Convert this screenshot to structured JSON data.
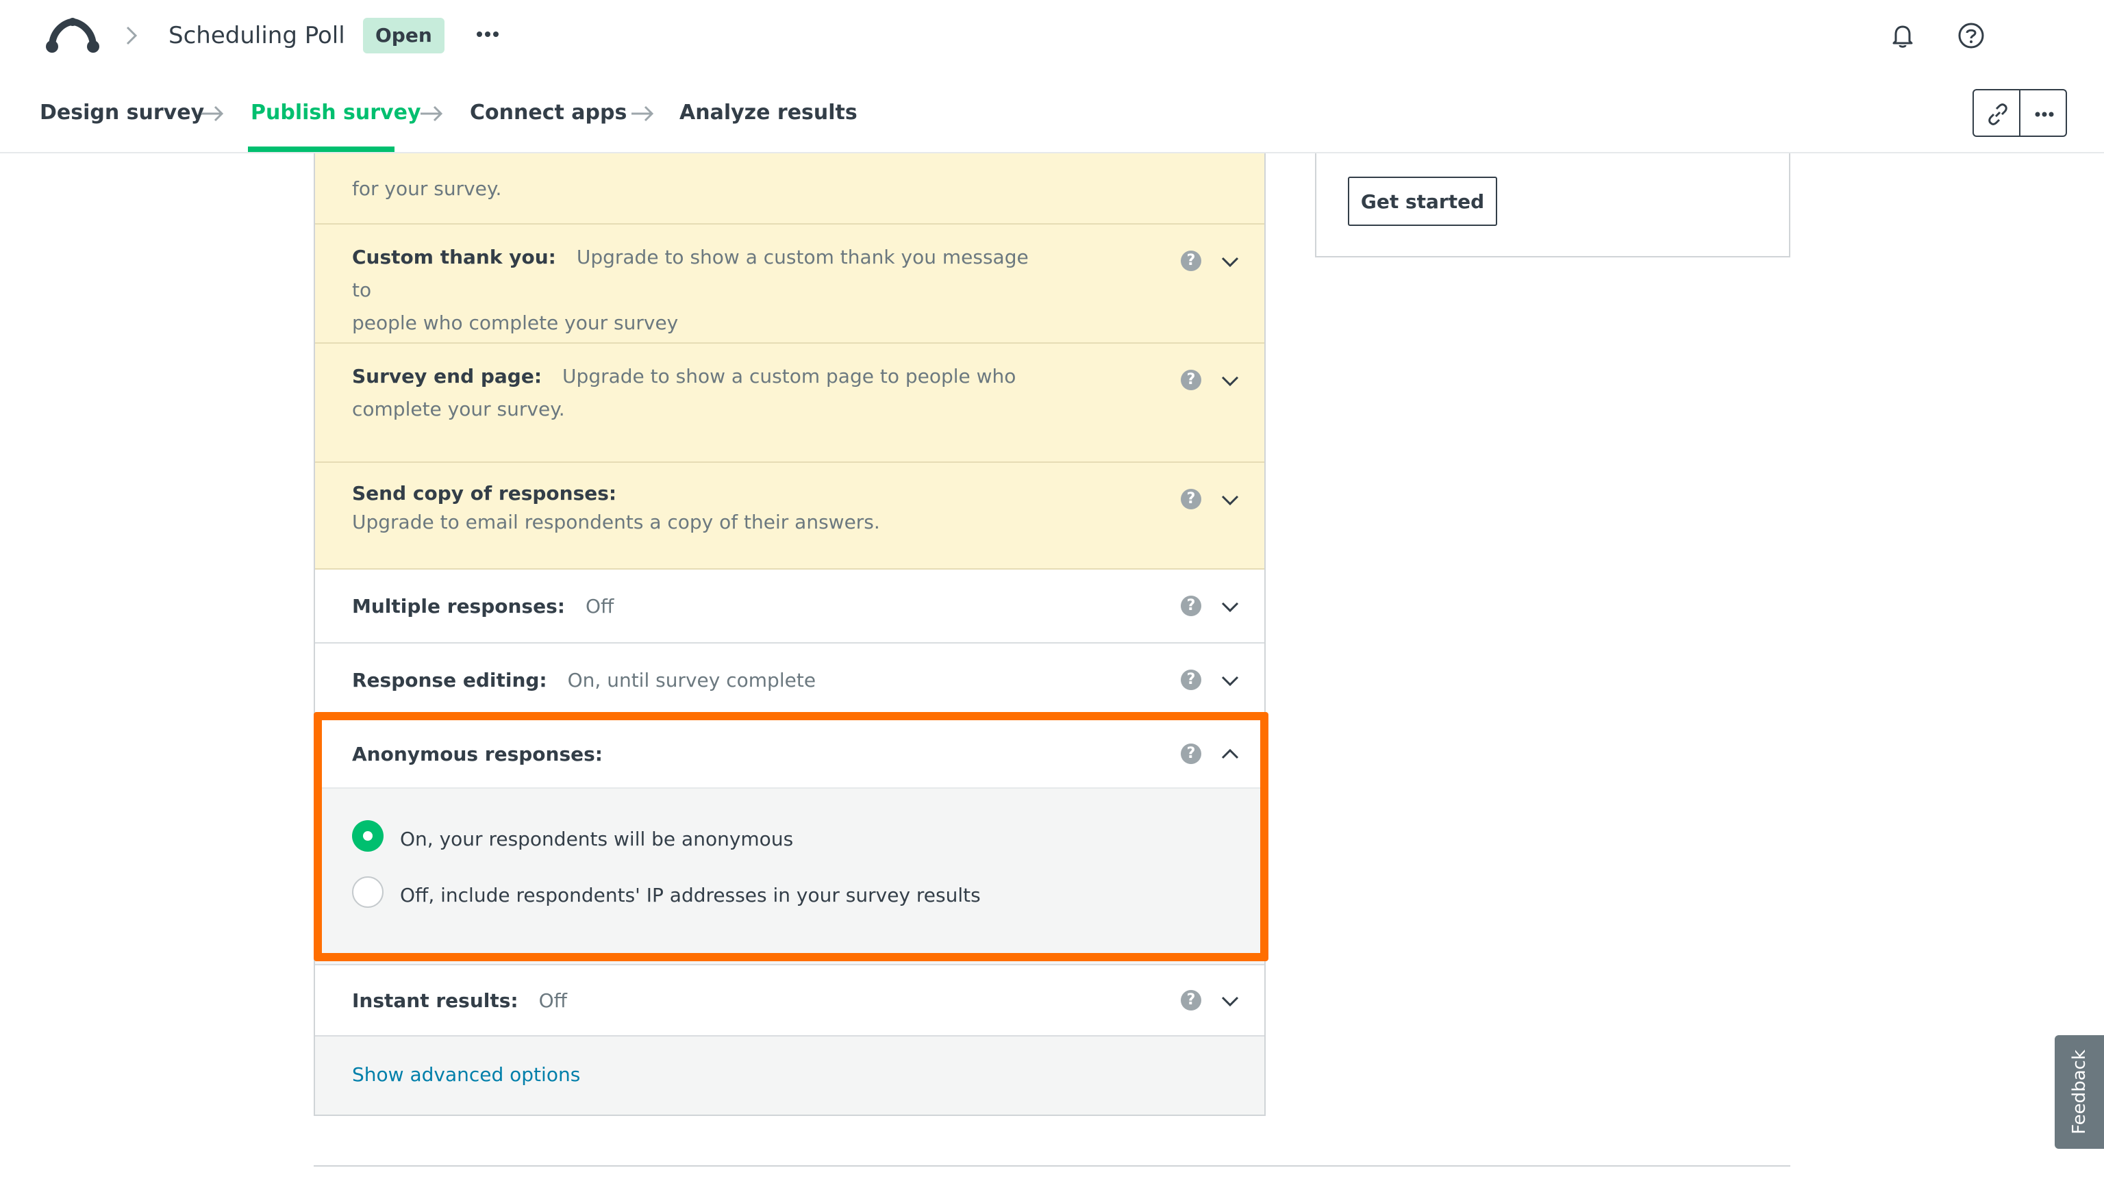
{
  "header": {
    "survey_title": "Scheduling Poll",
    "status": "Open"
  },
  "nav": {
    "steps": [
      {
        "label": "Design survey"
      },
      {
        "label": "Publish survey"
      },
      {
        "label": "Connect apps"
      },
      {
        "label": "Analyze results"
      }
    ],
    "active_step": "Publish survey"
  },
  "options": {
    "recurrence": {
      "desc": "for your survey."
    },
    "custom_thank_you": {
      "title": "Custom thank you:",
      "desc1": "Upgrade to show a custom thank you message to",
      "desc2": "people who complete your survey"
    },
    "survey_end_page": {
      "title": "Survey end page:",
      "desc1": "Upgrade to show a custom page to people who",
      "desc2": "complete your survey."
    },
    "send_copy": {
      "title": "Send copy of responses:",
      "desc": "Upgrade to email respondents a copy of their answers."
    },
    "multiple_responses": {
      "title": "Multiple responses:",
      "value": "Off"
    },
    "response_editing": {
      "title": "Response editing:",
      "value": "On, until survey complete"
    },
    "anonymous_responses": {
      "title": "Anonymous responses:",
      "choices": [
        {
          "label": "On, your respondents will be anonymous",
          "selected": true
        },
        {
          "label": "Off, include respondents' IP addresses in your survey results",
          "selected": false
        }
      ]
    },
    "instant_results": {
      "title": "Instant results:",
      "value": "Off"
    },
    "advanced_link": "Show advanced options"
  },
  "sidebar_card": {
    "button_label": "Get started"
  },
  "feedback_tab": "Feedback",
  "colors": {
    "brand_green": "#00bf6f",
    "upgrade_bg": "#fdf5d3",
    "highlight": "#ff6e00",
    "link": "#007faa"
  }
}
